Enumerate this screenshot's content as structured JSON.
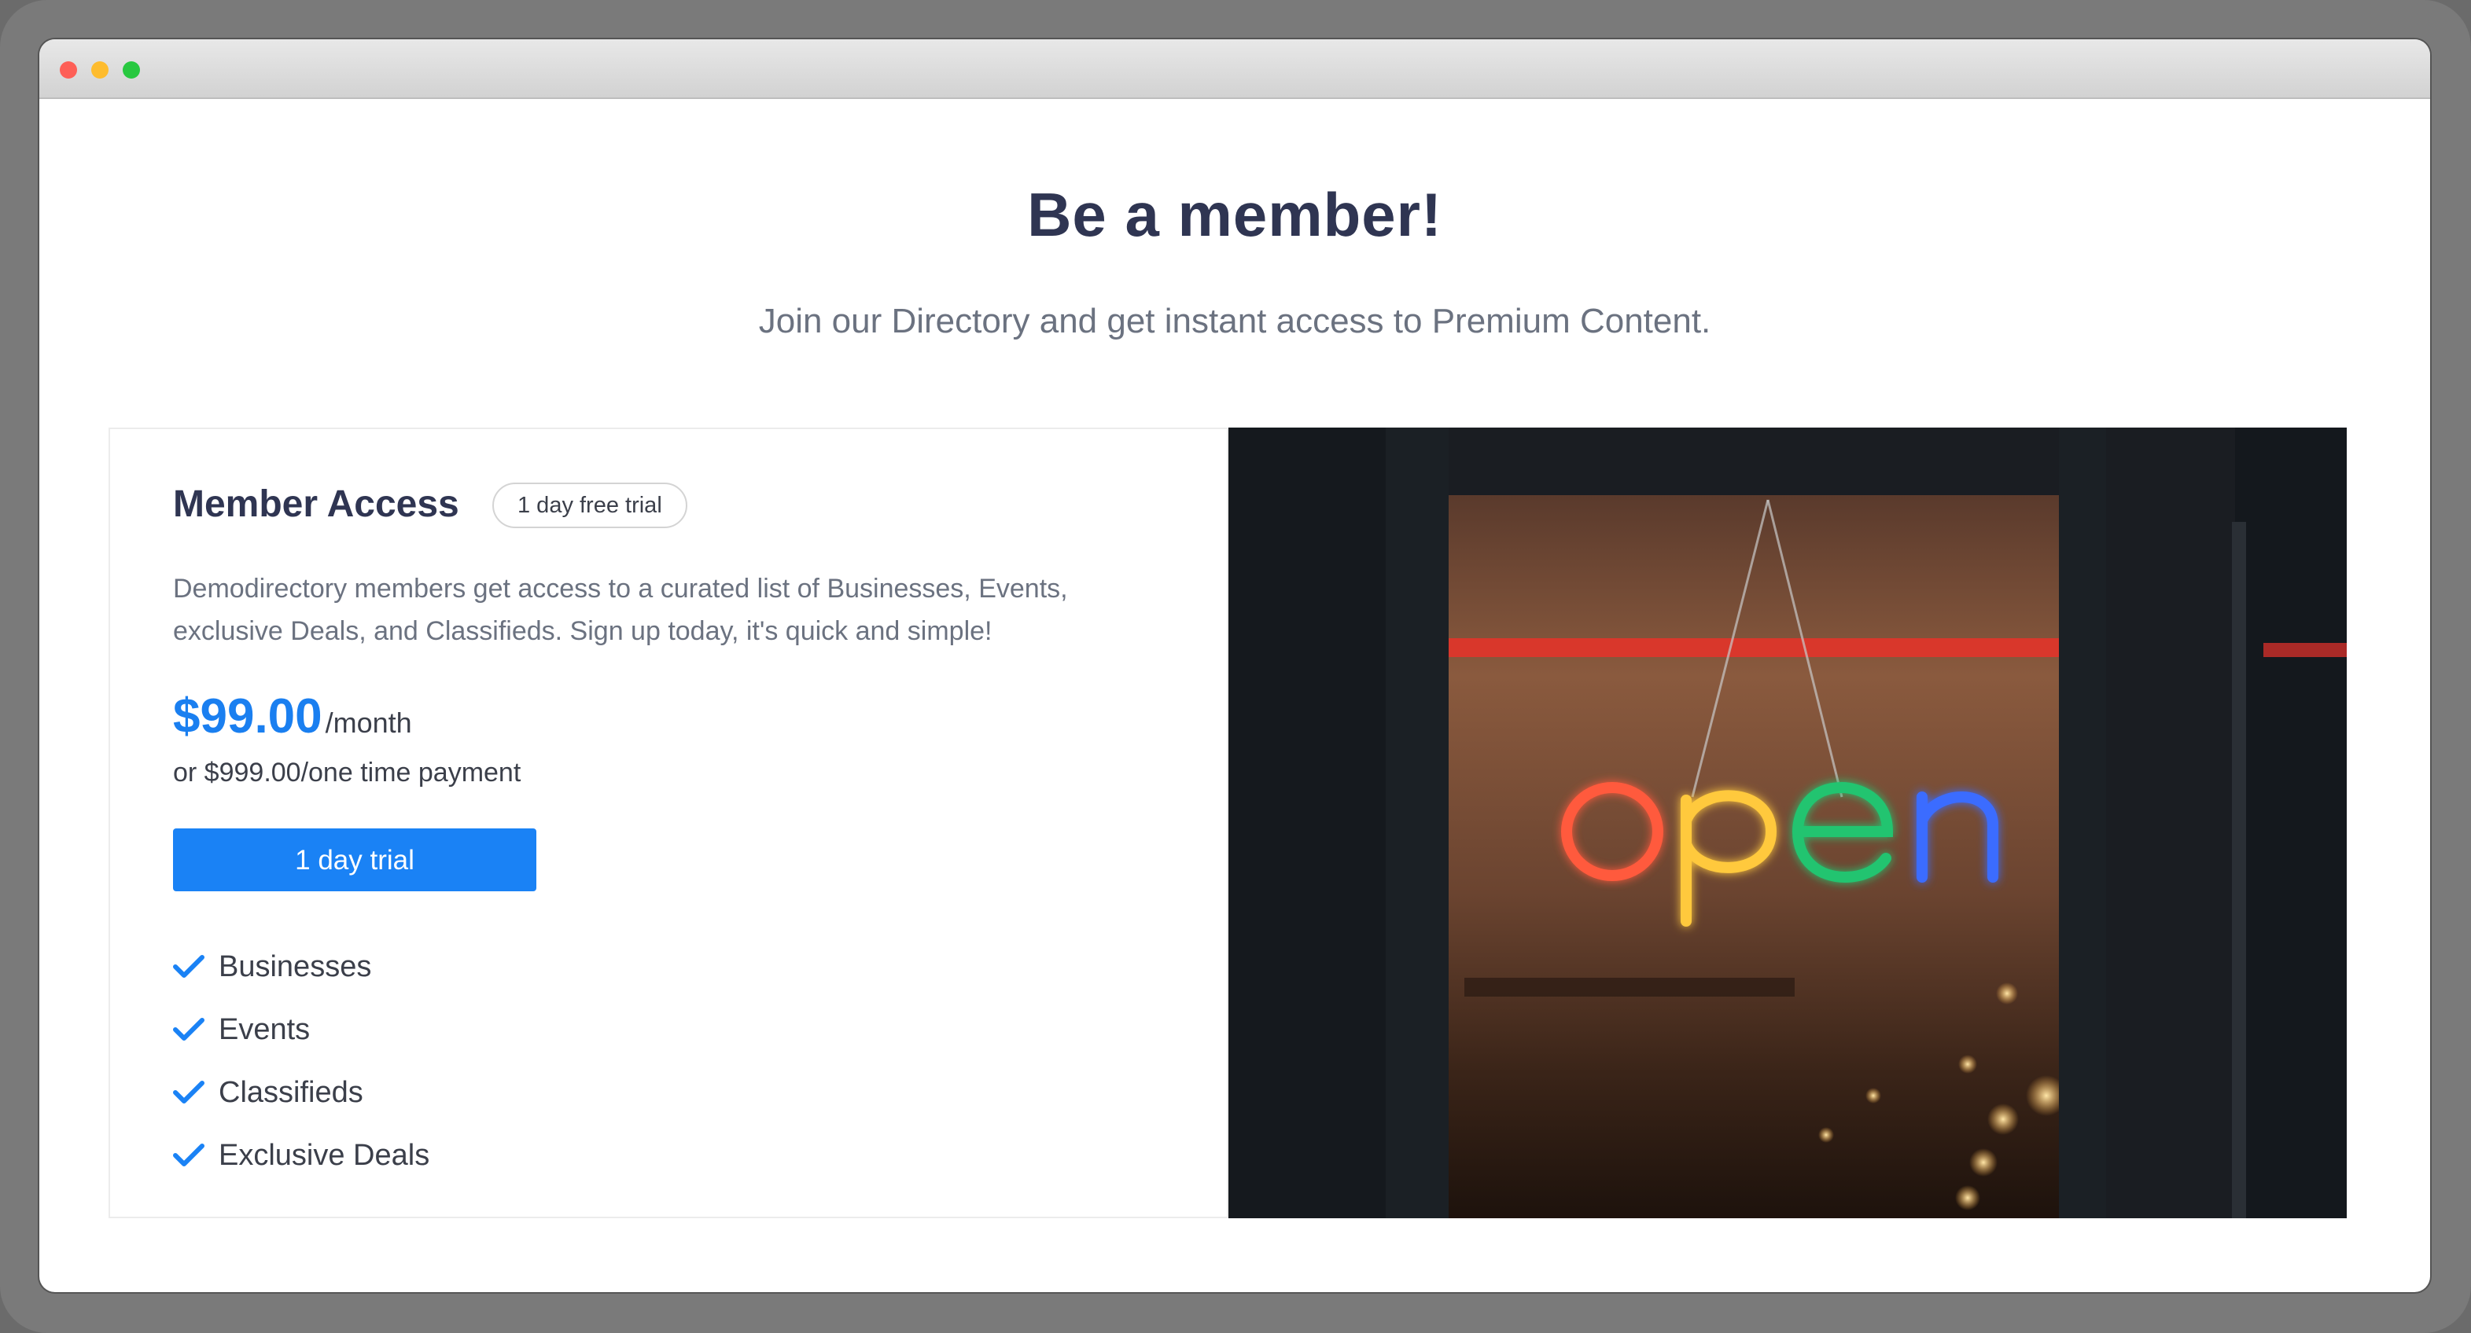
{
  "hero": {
    "title": "Be a member!",
    "subtitle": "Join our Directory and get instant access to Premium Content."
  },
  "plan": {
    "name": "Member Access",
    "badge": "1 day free trial",
    "description": "Demodirectory members get access to a curated list of Businesses, Events, exclusive Deals, and Classifieds. Sign up today, it's quick and simple!",
    "price": "$99.00",
    "period": "/month",
    "alt_price": "or $999.00/one time payment",
    "cta_label": "1 day trial",
    "features": [
      "Businesses",
      "Events",
      "Classifieds",
      "Exclusive Deals"
    ]
  },
  "photo": {
    "sign_text": "open",
    "image_icon": "neon-open-sign-photo"
  },
  "colors": {
    "accent": "#1a82f5",
    "price": "#1a7ff0",
    "heading": "#2f3552",
    "body_text": "#6b7280"
  }
}
